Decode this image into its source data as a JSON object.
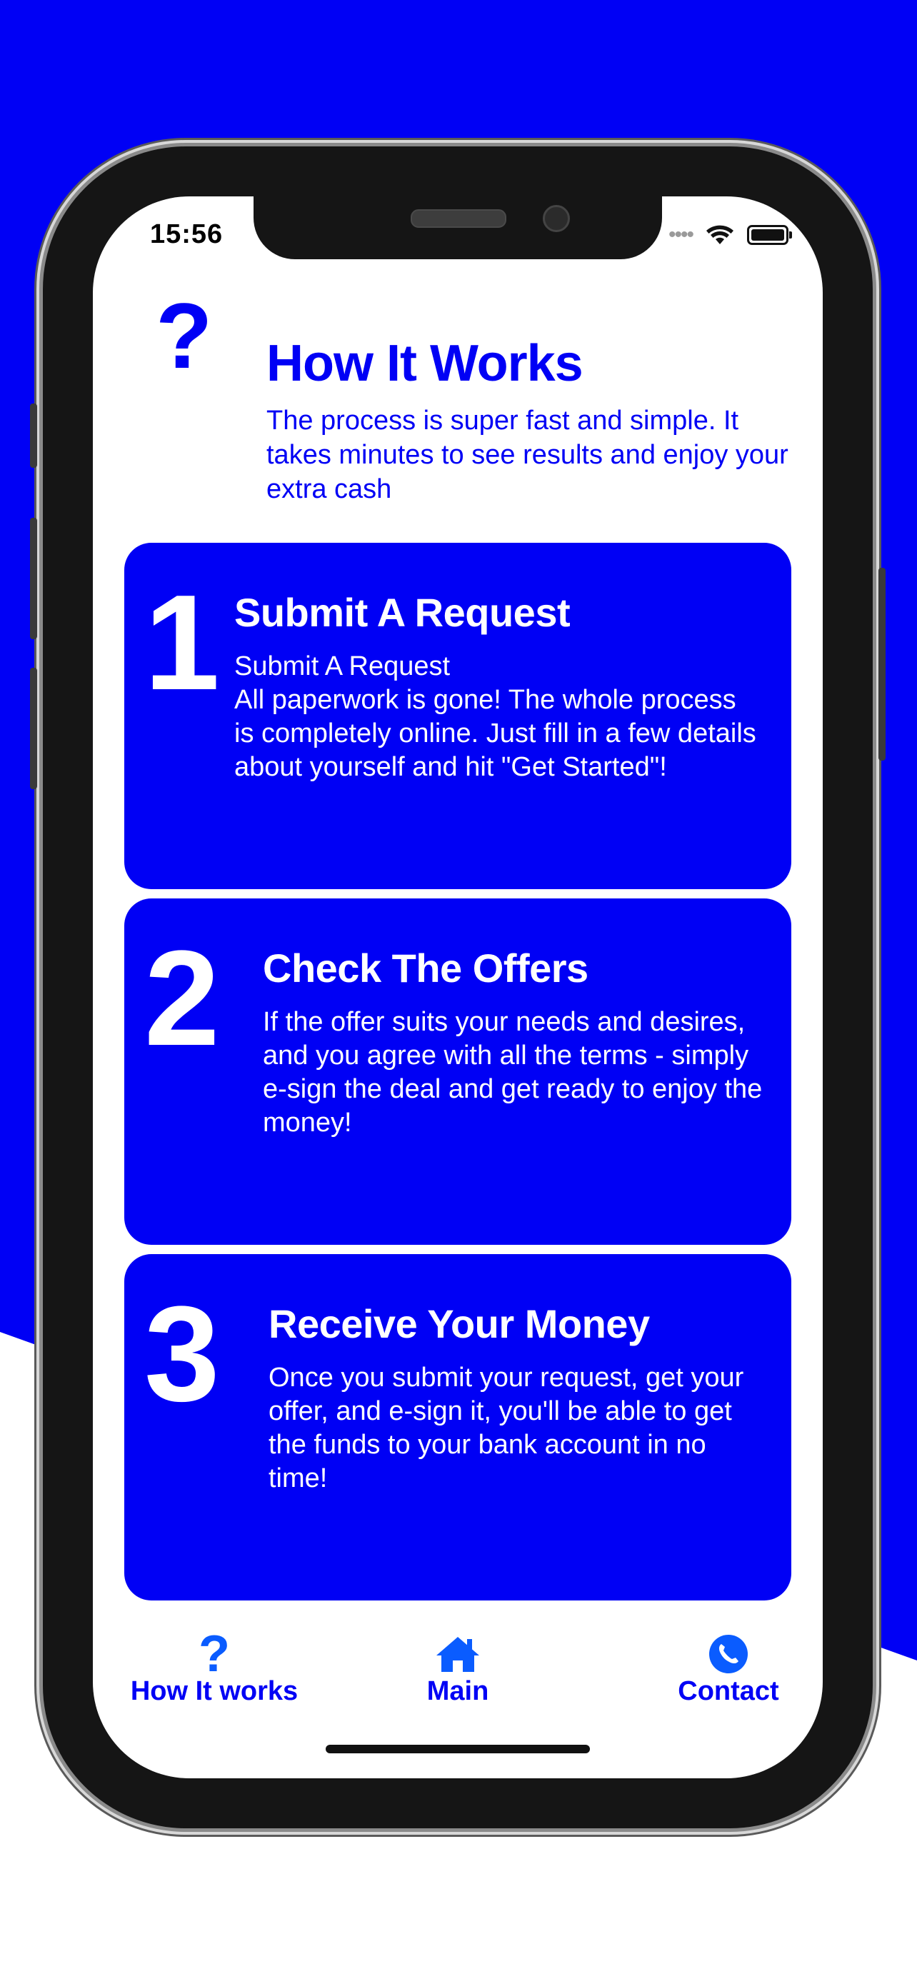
{
  "status": {
    "time": "15:56",
    "signal_dots": "••••"
  },
  "header": {
    "title": "How It Works",
    "subtitle": "The process is super fast and simple. It takes minutes to see results and enjoy your extra cash"
  },
  "steps": [
    {
      "number": "1",
      "title": "Submit A Request",
      "body_line1": "Submit A Request",
      "body": "All paperwork is gone! The whole process is completely online. Just fill in a few details about yourself and hit \"Get Started\"!"
    },
    {
      "number": "2",
      "title": "Check The Offers",
      "body": "If the offer suits your needs and desires, and you agree with all the terms - simply e-sign the deal and get ready to enjoy the money!"
    },
    {
      "number": "3",
      "title": "Receive Your Money",
      "body": "Once you submit your request, get your offer, and e-sign it, you'll be able to get the funds to your bank account in no time!"
    }
  ],
  "tabbar": {
    "items": [
      {
        "label": "How It works",
        "icon": "question-icon"
      },
      {
        "label": "Main",
        "icon": "home-icon"
      },
      {
        "label": "Contact",
        "icon": "phone-icon"
      }
    ]
  },
  "colors": {
    "brand_blue": "#0000f5",
    "tab_icon_blue": "#0a5cff"
  }
}
